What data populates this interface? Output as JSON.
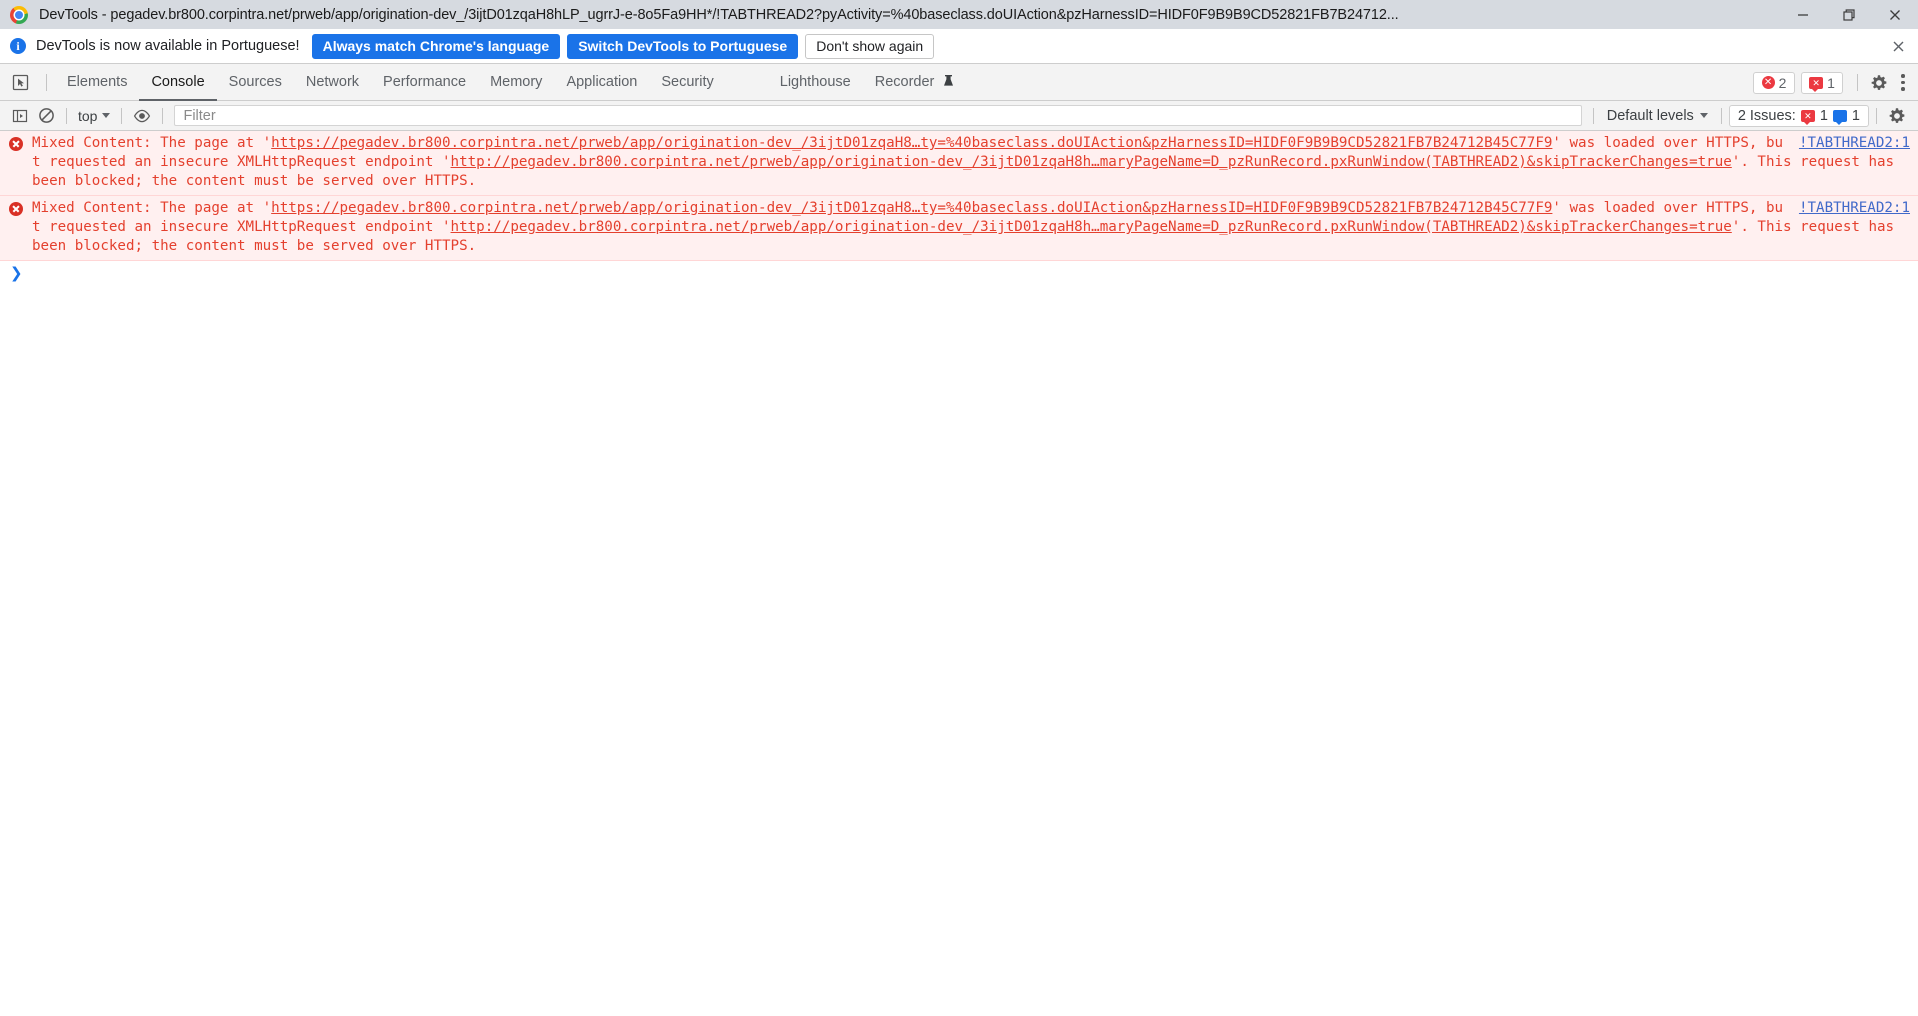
{
  "window": {
    "title": "DevTools - pegadev.br800.corpintra.net/prweb/app/origination-dev_/3ijtD01zqaH8hLP_ugrrJ-e-8o5Fa9HH*/!TABTHREAD2?pyActivity=%40baseclass.doUIAction&pzHarnessID=HIDF0F9B9B9CD52821FB7B24712...",
    "minimize_label": "Minimize",
    "maximize_label": "Restore",
    "close_label": "Close"
  },
  "infobar": {
    "icon": "info-icon",
    "message": "DevTools is now available in Portuguese!",
    "primary_button": "Always match Chrome's language",
    "secondary_button": "Switch DevTools to Portuguese",
    "dismiss_button": "Don't show again",
    "close_label": "Close"
  },
  "tabs": [
    {
      "label": "Elements",
      "active": false
    },
    {
      "label": "Console",
      "active": true
    },
    {
      "label": "Sources",
      "active": false
    },
    {
      "label": "Network",
      "active": false
    },
    {
      "label": "Performance",
      "active": false
    },
    {
      "label": "Memory",
      "active": false
    },
    {
      "label": "Application",
      "active": false
    },
    {
      "label": "Security",
      "active": false
    },
    {
      "label": "Lighthouse",
      "active": false
    },
    {
      "label": "Recorder",
      "active": false,
      "badge": "flask-icon"
    }
  ],
  "tabbar_right": {
    "error_count": "2",
    "issue_count": "1",
    "settings_label": "Settings",
    "more_label": "Customize and control DevTools"
  },
  "console_toolbar": {
    "sidebar_toggle": "console-sidebar-icon",
    "clear_label": "Clear console",
    "context": "top",
    "eye_label": "Live expression",
    "filter_placeholder": "Filter",
    "filter_value": "",
    "levels": "Default levels",
    "issues_label": "2 Issues:",
    "issues_error_count": "1",
    "issues_info_count": "1",
    "settings_label": "Console settings"
  },
  "console": {
    "messages": [
      {
        "level": "error",
        "pre": "Mixed Content: The page at '",
        "url1": "https://pegadev.br800.corpintra.net/prweb/app/origination-dev_/3ijtD01zqaH8…ty=%40baseclass.doUIAction&pzHarnessID=HIDF0F9B9B9CD52821FB7B24712B4",
        "url1_tail": "5C77F9",
        "mid": "' was loaded over HTTPS, but requested an insecure XMLHttpRequest endpoint '",
        "url2": "http://pegadev.br800.corpintra.net/prweb/app/origination-dev_/3ijtD01zqaH8h…maryPageName=D_pzRunRecord.pxRunWindow(TABTHREAD2)&skipTrackerChanges=true",
        "post": "'. This request has been blocked; the content must be served over HTTPS.",
        "source": "!TABTHREAD2:1"
      },
      {
        "level": "error",
        "pre": "Mixed Content: The page at '",
        "url1": "https://pegadev.br800.corpintra.net/prweb/app/origination-dev_/3ijtD01zqaH8…ty=%40baseclass.doUIAction&pzHarnessID=HIDF0F9B9B9CD52821FB7B24712B4",
        "url1_tail": "5C77F9",
        "mid": "' was loaded over HTTPS, but requested an insecure XMLHttpRequest endpoint '",
        "url2": "http://pegadev.br800.corpintra.net/prweb/app/origination-dev_/3ijtD01zqaH8h…maryPageName=D_pzRunRecord.pxRunWindow(TABTHREAD2)&skipTrackerChanges=true",
        "post": "'. This request has been blocked; the content must be served over HTTPS.",
        "source": "!TABTHREAD2:1"
      }
    ],
    "prompt_caret": "❯"
  },
  "colors": {
    "error_red": "#e4402e",
    "error_bg": "#fff0f0",
    "link_blue": "#4169c9",
    "accent_blue": "#1a73e8",
    "titlebar_bg": "#d6dae0",
    "toolbar_bg": "#f3f3f3"
  }
}
